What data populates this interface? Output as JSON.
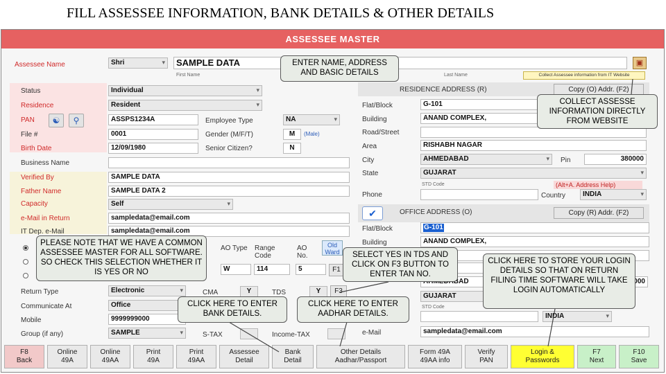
{
  "slide_title": "FILL ASSESSEE  INFORMATION, BANK DETAILS & OTHER DETAILS",
  "header": "ASSESSEE MASTER",
  "name_row": {
    "label": "Assessee Name",
    "salutation": "Shri",
    "first_name": "SAMPLE DATA",
    "first_name_caption": "First Name",
    "last_name_caption": "Last Name",
    "website_link": "Collect Assessee information from IT Website"
  },
  "left": {
    "status_label": "Status",
    "status": "Individual",
    "residence_label": "Residence",
    "residence": "Resident",
    "pan_label": "PAN",
    "pan": "ASSPS1234A",
    "file_label": "File #",
    "file": "0001",
    "dob_label": "Birth Date",
    "dob": "12/09/1980",
    "business_label": "Business Name",
    "business": "",
    "verified_label": "Verified By",
    "verified": "SAMPLE DATA",
    "father_label": "Father Name",
    "father": "SAMPLE DATA 2",
    "capacity_label": "Capacity",
    "capacity": "Self",
    "email_label": "e-Mail in Return",
    "email": "sampledata@email.com",
    "itdep_label": "IT Dep. e-Mail",
    "itdep": "sampledata@email.com",
    "return_type_label": "Return Type",
    "return_type": "Electronic",
    "communicate_label": "Communicate At",
    "communicate": "Office",
    "mobile_label": "Mobile",
    "mobile": "9999999000",
    "group_label": "Group (if any)",
    "group": "SAMPLE"
  },
  "mid": {
    "emp_type_label": "Employee Type",
    "emp_type": "NA",
    "gender_label": "Gender (M/F/T)",
    "gender": "M",
    "gender_hint": "(Male)",
    "senior_label": "Senior Citizen?",
    "senior": "N",
    "ao_type_label": "AO Type",
    "ao_type": "W",
    "range_label": "Range Code",
    "range": "114",
    "ao_no_label": "AO No.",
    "ao_no": "5",
    "old_ward_label": "Old Ward",
    "f1": "F1",
    "cma_label": "CMA",
    "cma": "Y",
    "tds_label": "TDS",
    "tds": "Y",
    "f3": "F3",
    "stax_label": "S-TAX",
    "income_tax": "Income-TAX"
  },
  "right": {
    "residence_head": "RESIDENCE ADDRESS (R)",
    "copy_o": "Copy (O) Addr. (F2)",
    "flat_label": "Flat/Block",
    "flat": "G-101",
    "building_label": "Building",
    "building": "ANAND COMPLEX,",
    "road_label": "Road/Street",
    "road": "",
    "area_label": "Area",
    "area": "RISHABH NAGAR",
    "city_label": "City",
    "city": "AHMEDABAD",
    "pin_label": "Pin",
    "pin": "380000",
    "state_label": "State",
    "state": "GUJARAT",
    "std_label": "STD Code",
    "help": "(Alt+A. Address Help)",
    "phone_label": "Phone",
    "country_label": "Country",
    "country": "INDIA",
    "office_head": "OFFICE ADDRESS (O)",
    "copy_r": "Copy (R) Addr. (F2)",
    "o_flat_label": "Flat/Block",
    "o_flat": "G-101",
    "o_building_label": "Building",
    "o_building": "ANAND COMPLEX,",
    "o_area_partial": "NAGAR",
    "o_city_partial": "AHMEDABAD",
    "o_pin_partial": "0000",
    "o_state": "GUJARAT",
    "o_std_label": "STD Code",
    "o_country": "INDIA",
    "o_email_label": "e-Mail",
    "o_email": "sampledata@email.com"
  },
  "callouts": {
    "enter_name": "ENTER NAME, ADDRESS AND BASIC DETAILS",
    "collect": "COLLECT ASSESSE INFORMATION DIRECTLY FROM WEBSITE",
    "please_note": "PLEASE NOTE THAT WE HAVE A COMMON ASSESSEE MASTER FOR ALL SOFTWARE. SO CHECK THIS SELECTION WHETHER IT IS YES OR NO",
    "select_yes": "SELECT YES IN TDS AND CLICK ON F3 BUTTON TO ENTER TAN NO.",
    "store_login": "CLICK HERE TO STORE YOUR LOGIN DETAILS SO THAT ON RETURN FILING TIME SOFTWARE WILL TAKE LOGIN AUTOMATICALLY",
    "bank": "CLICK HERE TO ENTER BANK DETAILS.",
    "aadhar": "CLICK HERE TO ENTER AADHAR DETAILS."
  },
  "fkeys": [
    {
      "l1": "F8",
      "l2": "Back"
    },
    {
      "l1": "Online",
      "l2": "49A"
    },
    {
      "l1": "Online",
      "l2": "49AA"
    },
    {
      "l1": "Print",
      "l2": "49A"
    },
    {
      "l1": "Print",
      "l2": "49AA"
    },
    {
      "l1": "Assessee",
      "l2": "Detail"
    },
    {
      "l1": "Bank",
      "l2": "Detail"
    },
    {
      "l1": "Other Details",
      "l2": "Aadhar/Passport"
    },
    {
      "l1": "Form 49A",
      "l2": "49AA info"
    },
    {
      "l1": "Verify",
      "l2": "PAN"
    },
    {
      "l1": "Login &",
      "l2": "Passwords"
    },
    {
      "l1": "F7",
      "l2": "Next"
    },
    {
      "l1": "F10",
      "l2": "Save"
    }
  ]
}
